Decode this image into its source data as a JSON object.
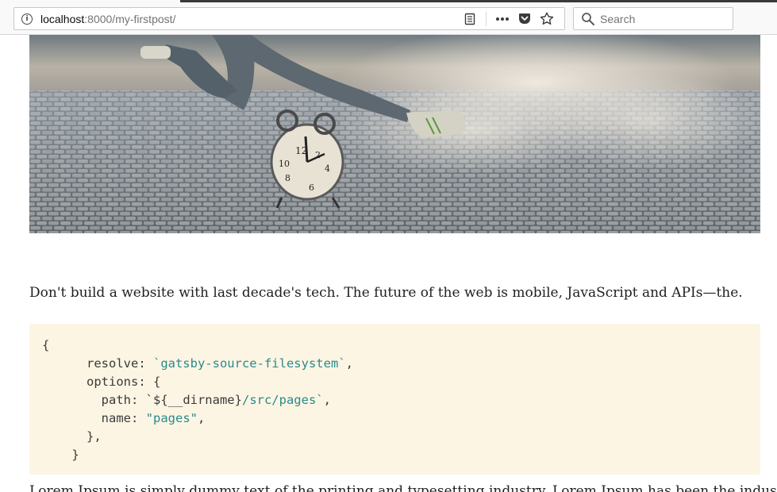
{
  "browser": {
    "url_host": "localhost",
    "url_rest": ":8000/my-firstpost/",
    "search_placeholder": "Search",
    "icons": [
      "info-icon",
      "reader-view-icon",
      "page-actions-icon",
      "pocket-icon",
      "bookmark-star-icon",
      "search-icon"
    ]
  },
  "hero": {
    "alt": "Runner leaping over an alarm clock on a cobblestone road"
  },
  "article": {
    "paragraph": "Don't build a website with last decade's tech. The future of the web is mobile, JavaScript and APIs—the.",
    "code_lines": [
      [
        {
          "t": "{",
          "c": "def"
        }
      ],
      [
        {
          "t": "      resolve: ",
          "c": "def"
        },
        {
          "t": "`gatsby-source-filesystem`",
          "c": "str"
        },
        {
          "t": ",",
          "c": "def"
        }
      ],
      [
        {
          "t": "      options: {",
          "c": "def"
        }
      ],
      [
        {
          "t": "        path: ",
          "c": "def"
        },
        {
          "t": "`${__dirname}",
          "c": "def"
        },
        {
          "t": "/src/pages`",
          "c": "str"
        },
        {
          "t": ",",
          "c": "def"
        }
      ],
      [
        {
          "t": "        name: ",
          "c": "def"
        },
        {
          "t": "\"pages\"",
          "c": "str"
        },
        {
          "t": ",",
          "c": "def"
        }
      ],
      [
        {
          "t": "      },",
          "c": "def"
        }
      ],
      [
        {
          "t": "    }",
          "c": "def"
        }
      ]
    ],
    "paragraph2": "Lorem Ipsum is simply dummy text of the printing and typesetting industry. Lorem Ipsum has been the industry's"
  },
  "colors": {
    "code_bg": "#fcf5e3",
    "code_string": "#2a8a8d",
    "text": "#1f1f1f"
  }
}
